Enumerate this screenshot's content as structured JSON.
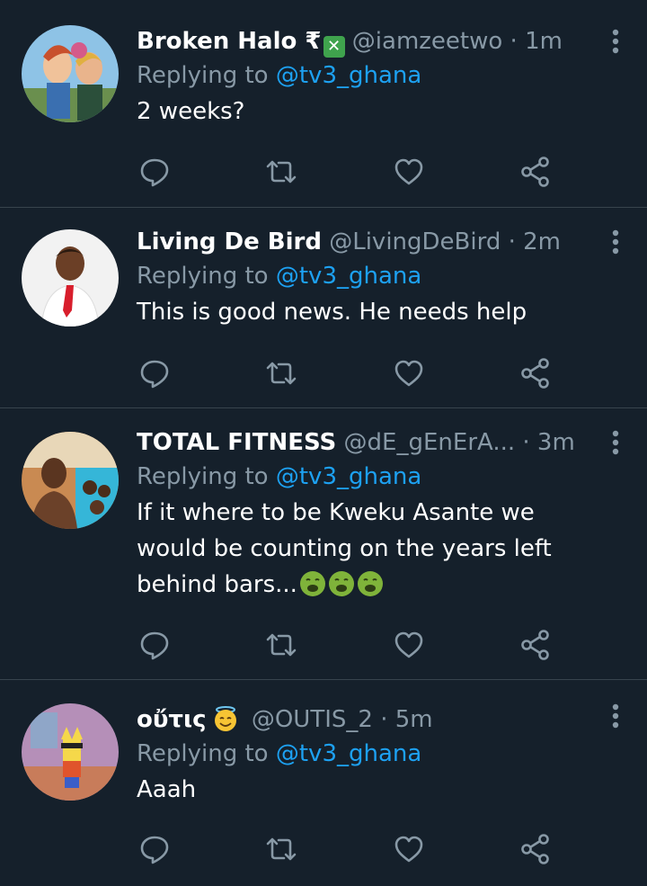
{
  "tweets": [
    {
      "name": "Broken Halo ₹",
      "badge": "✕",
      "handle": "@iamzeetwo",
      "time": "· 1m",
      "replying_prefix": "Replying to ",
      "replying_to": "@tv3_ghana",
      "text_lines": [
        "2 weeks?"
      ]
    },
    {
      "name": "Living De Bird",
      "handle": "@LivingDeBird",
      "time": "· 2m",
      "replying_prefix": "Replying to ",
      "replying_to": "@tv3_ghana",
      "text_lines": [
        "This is good news. He needs help"
      ]
    },
    {
      "name": "TOTAL FITNESS",
      "handle": "@dE_gEnErA...",
      "time": "· 3m",
      "replying_prefix": "Replying to ",
      "replying_to": "@tv3_ghana",
      "text_lines": [
        "If it where to be Kweku Asante we",
        "would be counting on the years left",
        "behind bars..."
      ],
      "trailing_emojis": [
        "nauseated-face-emoji",
        "nauseated-face-emoji",
        "nauseated-face-emoji"
      ]
    },
    {
      "name": "οὔτις",
      "name_emoji": "smiling-face-with-halo-emoji",
      "handle": "@OUTIS_2",
      "time": "· 5m",
      "replying_prefix": "Replying to ",
      "replying_to": "@tv3_ghana",
      "text_lines": [
        "Aaah"
      ]
    }
  ],
  "actions": [
    "reply-icon",
    "retweet-icon",
    "like-icon",
    "share-icon"
  ],
  "colors": {
    "background": "#15202b",
    "divider": "#38444d",
    "secondary_text": "#8899a6",
    "link": "#1da1f2",
    "primary_text": "#ffffff"
  }
}
